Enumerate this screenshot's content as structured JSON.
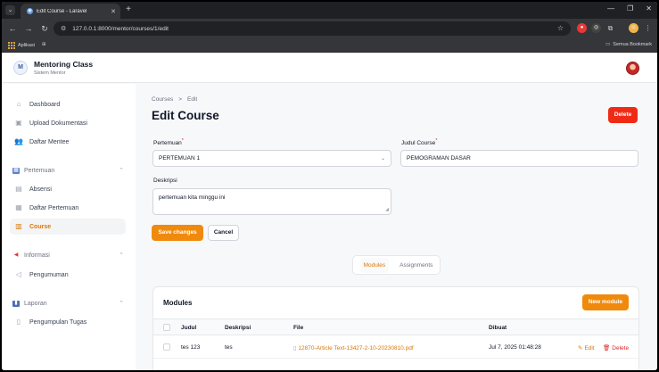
{
  "browser": {
    "tab_title": "Edit Course - Laravel",
    "url": "127.0.0.1:8000/mentor/courses/1/edit",
    "bookmark_apps": "Aplikasi",
    "all_bookmarks": "Semua Bookmark"
  },
  "header": {
    "brand": "Mentoring Class",
    "subtitle": "Sistem Mentor"
  },
  "sidebar": {
    "top_items": [
      {
        "label": "Dashboard",
        "icon": "home-icon"
      },
      {
        "label": "Upload Dokumentasi",
        "icon": "image-icon"
      },
      {
        "label": "Daftar Mentee",
        "icon": "users-icon"
      }
    ],
    "groups": [
      {
        "label": "Pertemuan",
        "icon": "calendar-icon",
        "items": [
          {
            "label": "Absensi",
            "icon": "clipboard-icon"
          },
          {
            "label": "Daftar Pertemuan",
            "icon": "calendar-days-icon"
          },
          {
            "label": "Course",
            "icon": "book-icon",
            "active": true
          }
        ]
      },
      {
        "label": "Informasi",
        "icon": "megaphone-icon",
        "items": [
          {
            "label": "Pengumuman",
            "icon": "megaphone-outline-icon"
          }
        ]
      },
      {
        "label": "Laporan",
        "icon": "chart-icon",
        "items": [
          {
            "label": "Pengumpulan Tugas",
            "icon": "document-icon"
          }
        ]
      }
    ]
  },
  "breadcrumb": {
    "parent": "Courses",
    "separator": ">",
    "current": "Edit"
  },
  "page_title": "Edit Course",
  "delete_label": "Delete",
  "form": {
    "pertemuan_label": "Pertemuan",
    "pertemuan_value": "PERTEMUAN 1",
    "judul_label": "Judul Course",
    "judul_value": "PEMOGRAMAN DASAR",
    "deskripsi_label": "Deskripsi",
    "deskripsi_value": "pertemuan kita minggu ini",
    "required_mark": "*",
    "save_label": "Save changes",
    "cancel_label": "Cancel"
  },
  "tabs": {
    "modules": "Modules",
    "assignments": "Assignments"
  },
  "modules": {
    "title": "Modules",
    "new_label": "New module",
    "columns": {
      "judul": "Judul",
      "deskripsi": "Deskripsi",
      "file": "File",
      "dibuat": "Dibuat"
    },
    "rows": [
      {
        "judul": "tes 123",
        "deskripsi": "tes",
        "file": "12870-Article Text-13427-2-10-20230810.pdf",
        "dibuat": "Jul 7, 2025 01:48:28"
      }
    ],
    "edit_label": "Edit",
    "delete_label": "Delete"
  },
  "colors": {
    "accent": "#f08a0c",
    "danger": "#ef2b16"
  }
}
